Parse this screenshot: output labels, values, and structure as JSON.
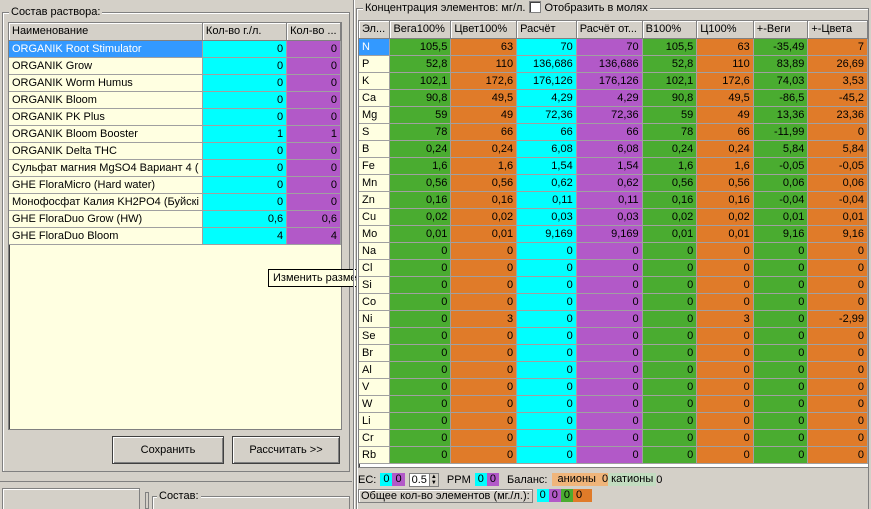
{
  "left_panel": {
    "title": "Состав раствора:",
    "columns": [
      "Наименование",
      "Кол-во г./л.",
      "Кол-во ..."
    ],
    "rows": [
      {
        "name": "ORGANIK Root Stimulator",
        "qty1": "0",
        "qty2": "0"
      },
      {
        "name": "ORGANIK Grow",
        "qty1": "0",
        "qty2": "0"
      },
      {
        "name": "ORGANIK Worm Humus",
        "qty1": "0",
        "qty2": "0"
      },
      {
        "name": "ORGANIK Bloom",
        "qty1": "0",
        "qty2": "0"
      },
      {
        "name": "ORGANIK PK Plus",
        "qty1": "0",
        "qty2": "0"
      },
      {
        "name": "ORGANIK Bloom Booster",
        "qty1": "1",
        "qty2": "1"
      },
      {
        "name": "ORGANIK Delta THC",
        "qty1": "0",
        "qty2": "0"
      },
      {
        "name": "Сульфат магния MgSO4 Вариант 4 (",
        "qty1": "0",
        "qty2": "0"
      },
      {
        "name": "GHE FloraMicro (Hard water)",
        "qty1": "0",
        "qty2": "0"
      },
      {
        "name": "Монофосфат Калия KH2PO4 (Буйскі",
        "qty1": "0",
        "qty2": "0"
      },
      {
        "name": "GHE FloraDuo Grow (HW)",
        "qty1": "0,6",
        "qty2": "0,6"
      },
      {
        "name": "GHE FloraDuo Bloom",
        "qty1": "4",
        "qty2": "4"
      }
    ],
    "save_label": "Сохранить",
    "calc_label": "Рассчитать >>"
  },
  "bottom_left": {
    "title": "Состав:"
  },
  "tooltip": "Изменить размер",
  "right_panel": {
    "title": "Концентрация элементов: мг/л.",
    "checkbox_label": "Отобразить в молях",
    "columns": [
      "Эл...",
      "Вега100%",
      "Цвет100%",
      "Расчёт",
      "Расчёт от...",
      "В100%",
      "Ц100%",
      "+-Веги",
      "+-Цвета"
    ],
    "rows": [
      {
        "el": "N",
        "v": [
          "105,5",
          "63",
          "70",
          "70",
          "105,5",
          "63",
          "-35,49",
          "7"
        ]
      },
      {
        "el": "P",
        "v": [
          "52,8",
          "110",
          "136,686",
          "136,686",
          "52,8",
          "110",
          "83,89",
          "26,69"
        ]
      },
      {
        "el": "K",
        "v": [
          "102,1",
          "172,6",
          "176,126",
          "176,126",
          "102,1",
          "172,6",
          "74,03",
          "3,53"
        ]
      },
      {
        "el": "Ca",
        "v": [
          "90,8",
          "49,5",
          "4,29",
          "4,29",
          "90,8",
          "49,5",
          "-86,5",
          "-45,2"
        ]
      },
      {
        "el": "Mg",
        "v": [
          "59",
          "49",
          "72,36",
          "72,36",
          "59",
          "49",
          "13,36",
          "23,36"
        ]
      },
      {
        "el": "S",
        "v": [
          "78",
          "66",
          "66",
          "66",
          "78",
          "66",
          "-11,99",
          "0"
        ]
      },
      {
        "el": "B",
        "v": [
          "0,24",
          "0,24",
          "6,08",
          "6,08",
          "0,24",
          "0,24",
          "5,84",
          "5,84"
        ]
      },
      {
        "el": "Fe",
        "v": [
          "1,6",
          "1,6",
          "1,54",
          "1,54",
          "1,6",
          "1,6",
          "-0,05",
          "-0,05"
        ]
      },
      {
        "el": "Mn",
        "v": [
          "0,56",
          "0,56",
          "0,62",
          "0,62",
          "0,56",
          "0,56",
          "0,06",
          "0,06"
        ]
      },
      {
        "el": "Zn",
        "v": [
          "0,16",
          "0,16",
          "0,11",
          "0,11",
          "0,16",
          "0,16",
          "-0,04",
          "-0,04"
        ]
      },
      {
        "el": "Cu",
        "v": [
          "0,02",
          "0,02",
          "0,03",
          "0,03",
          "0,02",
          "0,02",
          "0,01",
          "0,01"
        ]
      },
      {
        "el": "Mo",
        "v": [
          "0,01",
          "0,01",
          "9,169",
          "9,169",
          "0,01",
          "0,01",
          "9,16",
          "9,16"
        ]
      },
      {
        "el": "Na",
        "v": [
          "0",
          "0",
          "0",
          "0",
          "0",
          "0",
          "0",
          "0"
        ]
      },
      {
        "el": "Cl",
        "v": [
          "0",
          "0",
          "0",
          "0",
          "0",
          "0",
          "0",
          "0"
        ]
      },
      {
        "el": "Si",
        "v": [
          "0",
          "0",
          "0",
          "0",
          "0",
          "0",
          "0",
          "0"
        ]
      },
      {
        "el": "Co",
        "v": [
          "0",
          "0",
          "0",
          "0",
          "0",
          "0",
          "0",
          "0"
        ]
      },
      {
        "el": "Ni",
        "v": [
          "0",
          "3",
          "0",
          "0",
          "0",
          "3",
          "0",
          "-2,99"
        ]
      },
      {
        "el": "Se",
        "v": [
          "0",
          "0",
          "0",
          "0",
          "0",
          "0",
          "0",
          "0"
        ]
      },
      {
        "el": "Br",
        "v": [
          "0",
          "0",
          "0",
          "0",
          "0",
          "0",
          "0",
          "0"
        ]
      },
      {
        "el": "Al",
        "v": [
          "0",
          "0",
          "0",
          "0",
          "0",
          "0",
          "0",
          "0"
        ]
      },
      {
        "el": "V",
        "v": [
          "0",
          "0",
          "0",
          "0",
          "0",
          "0",
          "0",
          "0"
        ]
      },
      {
        "el": "W",
        "v": [
          "0",
          "0",
          "0",
          "0",
          "0",
          "0",
          "0",
          "0"
        ]
      },
      {
        "el": "Li",
        "v": [
          "0",
          "0",
          "0",
          "0",
          "0",
          "0",
          "0",
          "0"
        ]
      },
      {
        "el": "Cr",
        "v": [
          "0",
          "0",
          "0",
          "0",
          "0",
          "0",
          "0",
          "0"
        ]
      },
      {
        "el": "Rb",
        "v": [
          "0",
          "0",
          "0",
          "0",
          "0",
          "0",
          "0",
          "0"
        ]
      }
    ],
    "column_colors": [
      "#4aac30",
      "#e07b29",
      "#00ffff",
      "#b259c8",
      "#4aac30",
      "#e07b29",
      "#4aac30",
      "#e07b29"
    ]
  },
  "status": {
    "ec_label": "EC:",
    "ec_val1": "0",
    "ec_val2": "0",
    "ec_spin": "0.5",
    "ppm_label": "PPM",
    "ppm_val1": "0",
    "ppm_val2": "0",
    "balance_label": "Баланс:",
    "anions_label": "анионы",
    "anions_val": "0",
    "cations_label": "катионы",
    "cations_val": "0",
    "total_label": "Общее кол-во элементов (мг./л.):",
    "total_vals": [
      "0",
      "0",
      "0",
      "0"
    ]
  }
}
